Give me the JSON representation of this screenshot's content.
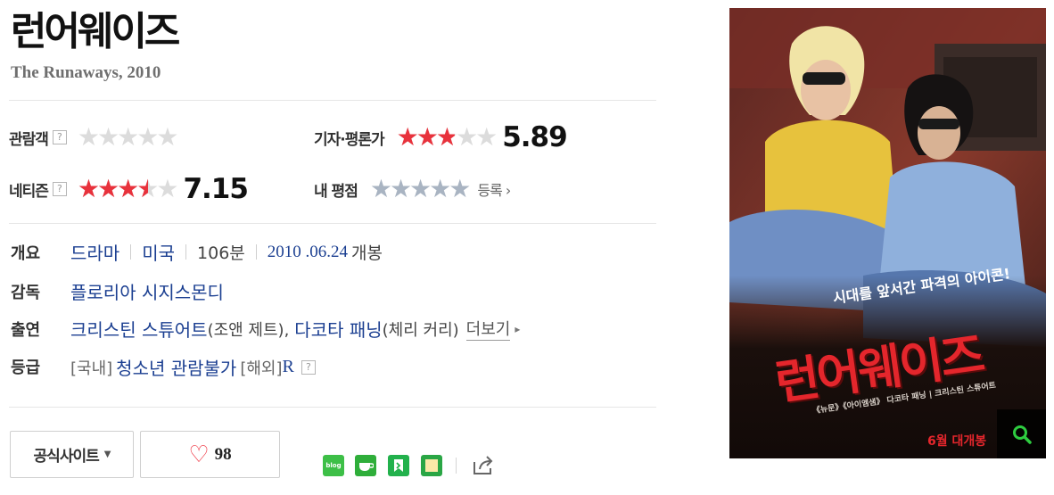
{
  "movie": {
    "title": "런어웨이즈",
    "subtitle": "The Runaways, 2010"
  },
  "ratings": {
    "audience": {
      "label": "관람객",
      "help": "?",
      "stars_fraction": 0
    },
    "critics": {
      "label": "기자·평론가",
      "score": "5.89",
      "stars_fraction": 0.589
    },
    "netizen": {
      "label": "네티즌",
      "help": "?",
      "score": "7.15",
      "stars_fraction": 0.715
    },
    "mine": {
      "label": "내 평점",
      "register_label": "등록",
      "register_arrow": "›",
      "stars_fraction": 0
    },
    "star_glyphs": "★★★★★"
  },
  "info": {
    "overview": {
      "label": "개요",
      "genre": "드라마",
      "country": "미국",
      "runtime": "106분",
      "release_date": "2010 .06.24",
      "release_suffix": "개봉"
    },
    "director": {
      "label": "감독",
      "name": "플로리아 시지스몬디"
    },
    "cast": {
      "label": "출연",
      "actor1": "크리스틴 스튜어트",
      "role1": "(조앤 제트),",
      "actor2": "다코타 패닝",
      "role2": "(체리 커리)",
      "more_label": "더보기",
      "more_arrow": "▸"
    },
    "rating_grade": {
      "label": "등급",
      "domestic_prefix": "[국내]",
      "domestic": "청소년 관람불가",
      "foreign_prefix": "[해외]",
      "foreign": "R",
      "help": "?"
    }
  },
  "actions": {
    "official_site_label": "공식사이트",
    "official_site_caret": "▼",
    "like_icon": "♡",
    "like_count": "98"
  },
  "share": {
    "blog_label": "blog",
    "icons": [
      "naver-blog-icon",
      "naver-cafe-icon",
      "keep-icon",
      "memo-icon",
      "share-icon"
    ]
  },
  "poster": {
    "tagline": "시대를 앞서간 파격의 아이콘!",
    "title": "런어웨이즈",
    "cast_line": "《뉴문》《아이엠샘》 다코타 패닝 | 크리스틴 스튜어트",
    "release": "6월 대개봉",
    "zoom_icon": "search-icon"
  },
  "colors": {
    "link": "#1b3f91",
    "star_red": "#e8323c",
    "star_gray": "#dcdcdc",
    "star_blue": "#a9b4c2",
    "heart": "#ee3340"
  }
}
